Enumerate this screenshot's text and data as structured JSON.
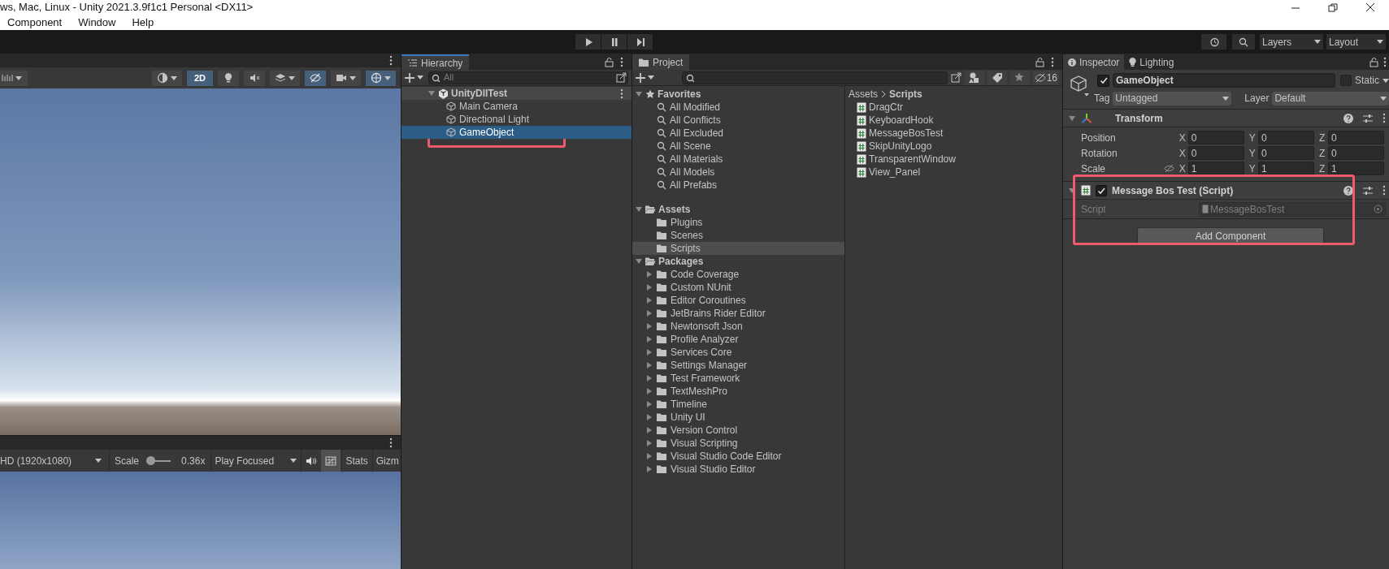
{
  "window": {
    "title": "ws, Mac, Linux - Unity 2021.3.9f1c1 Personal <DX11>"
  },
  "menu": [
    "Component",
    "Window",
    "Help"
  ],
  "toolbar": {
    "layers": "Layers",
    "layout": "Layout"
  },
  "scene_toolbar": [
    {
      "kind": "shading",
      "selected": false
    },
    {
      "kind": "mode",
      "label": "2D",
      "selected": true
    },
    {
      "kind": "lighting",
      "selected": false
    },
    {
      "kind": "audio",
      "selected": false
    },
    {
      "kind": "effects",
      "selected": false
    },
    {
      "kind": "visibility",
      "selected": true
    },
    {
      "kind": "camera",
      "selected": false
    },
    {
      "kind": "gizmos",
      "selected": true
    }
  ],
  "game_toolbar": {
    "resolution": "HD (1920x1080)",
    "scale_label": "Scale",
    "level": 0.1,
    "scale_value": "0.36x",
    "play_mode": "Play Focused",
    "stats": "Stats",
    "gizmos": "Gizm"
  },
  "hierarchy": {
    "tab": "Hierarchy",
    "placeholder": "All",
    "scene": {
      "name": "UnityDllTest",
      "expanded": true,
      "children": [
        {
          "name": "Main Camera",
          "selected": false,
          "highlighted": false
        },
        {
          "name": "Directional Light",
          "selected": false,
          "highlighted": false
        },
        {
          "name": "GameObject",
          "selected": true,
          "highlighted": true
        }
      ]
    }
  },
  "project": {
    "tab": "Project",
    "hidden_count": "16",
    "tree": [
      {
        "label": "Favorites",
        "kind": "favorites",
        "expanded": true,
        "selected": false,
        "children": [
          {
            "label": "All Modified",
            "kind": "search",
            "selected": false
          },
          {
            "label": "All Conflicts",
            "kind": "search",
            "selected": false
          },
          {
            "label": "All Excluded",
            "kind": "search",
            "selected": false
          },
          {
            "label": "All Scene",
            "kind": "search",
            "selected": false
          },
          {
            "label": "All Materials",
            "kind": "search",
            "selected": false
          },
          {
            "label": "All Models",
            "kind": "search",
            "selected": false
          },
          {
            "label": "All Prefabs",
            "kind": "search",
            "selected": false
          }
        ]
      },
      {
        "label": "Assets",
        "kind": "folder",
        "expanded": true,
        "selected": false,
        "children": [
          {
            "label": "Plugins",
            "kind": "folder",
            "selected": false
          },
          {
            "label": "Scenes",
            "kind": "folder",
            "selected": false
          },
          {
            "label": "Scripts",
            "kind": "folder",
            "selected": true
          }
        ]
      },
      {
        "label": "Packages",
        "kind": "folder",
        "expanded": true,
        "selected": false,
        "children": [
          {
            "label": "Code Coverage",
            "kind": "folder",
            "expanded": false,
            "selected": false
          },
          {
            "label": "Custom NUnit",
            "kind": "folder",
            "expanded": false,
            "selected": false
          },
          {
            "label": "Editor Coroutines",
            "kind": "folder",
            "expanded": false,
            "selected": false
          },
          {
            "label": "JetBrains Rider Editor",
            "kind": "folder",
            "expanded": false,
            "selected": false
          },
          {
            "label": "Newtonsoft Json",
            "kind": "folder",
            "expanded": false,
            "selected": false
          },
          {
            "label": "Profile Analyzer",
            "kind": "folder",
            "expanded": false,
            "selected": false
          },
          {
            "label": "Services Core",
            "kind": "folder",
            "expanded": false,
            "selected": false
          },
          {
            "label": "Settings Manager",
            "kind": "folder",
            "expanded": false,
            "selected": false
          },
          {
            "label": "Test Framework",
            "kind": "folder",
            "expanded": false,
            "selected": false
          },
          {
            "label": "TextMeshPro",
            "kind": "folder",
            "expanded": false,
            "selected": false
          },
          {
            "label": "Timeline",
            "kind": "folder",
            "expanded": false,
            "selected": false
          },
          {
            "label": "Unity UI",
            "kind": "folder",
            "expanded": false,
            "selected": false
          },
          {
            "label": "Version Control",
            "kind": "folder",
            "expanded": false,
            "selected": false
          },
          {
            "label": "Visual Scripting",
            "kind": "folder",
            "expanded": false,
            "selected": false
          },
          {
            "label": "Visual Studio Code Editor",
            "kind": "folder",
            "expanded": false,
            "selected": false
          },
          {
            "label": "Visual Studio Editor",
            "kind": "folder",
            "expanded": false,
            "selected": false
          }
        ]
      }
    ],
    "breadcrumb": [
      "Assets",
      "Scripts"
    ],
    "files": [
      "DragCtr",
      "KeyboardHook",
      "MessageBosTest",
      "SkipUnityLogo",
      "TransparentWindow",
      "View_Panel"
    ]
  },
  "inspector": {
    "tabs": [
      {
        "label": "Inspector",
        "selected": true
      },
      {
        "label": "Lighting",
        "selected": false
      }
    ],
    "object": {
      "active": true,
      "name": "GameObject",
      "static": false,
      "static_label": "Static",
      "tag_label": "Tag",
      "tag": "Untagged",
      "layer_label": "Layer",
      "layer": "Default"
    },
    "transform": {
      "title": "Transform",
      "expanded": true,
      "rows": [
        {
          "label": "Position",
          "fields": [
            {
              "axis": "X",
              "value": "0"
            },
            {
              "axis": "Y",
              "value": "0"
            },
            {
              "axis": "Z",
              "value": "0"
            }
          ]
        },
        {
          "label": "Rotation",
          "fields": [
            {
              "axis": "X",
              "value": "0"
            },
            {
              "axis": "Y",
              "value": "0"
            },
            {
              "axis": "Z",
              "value": "0"
            }
          ]
        },
        {
          "label": "Scale",
          "fields": [
            {
              "axis": "X",
              "value": "1"
            },
            {
              "axis": "Y",
              "value": "1"
            },
            {
              "axis": "Z",
              "value": "1"
            }
          ]
        }
      ]
    },
    "script_component": {
      "title": "Message Bos Test (Script)",
      "enabled": true,
      "expanded": true,
      "highlighted": true,
      "field_label": "Script",
      "field_value": "MessageBosTest"
    },
    "add_component": "Add Component"
  }
}
